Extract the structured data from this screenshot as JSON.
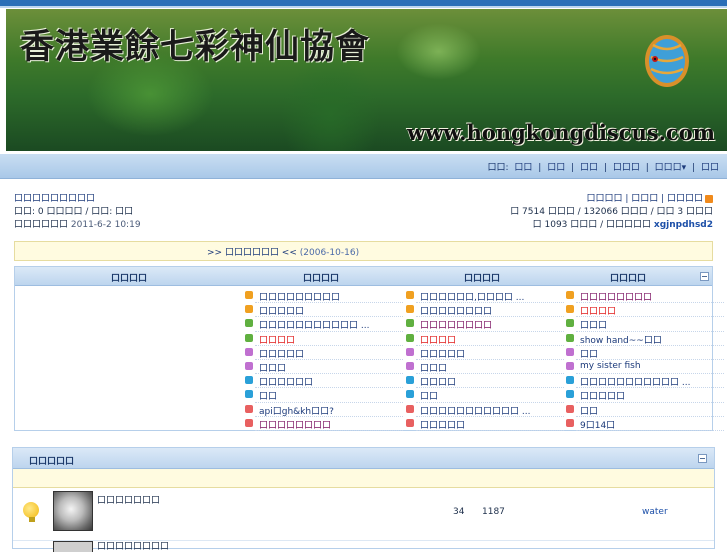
{
  "banner": {
    "title": "香港業餘七彩神仙協會",
    "url": "www.hongkongdiscus.com"
  },
  "nav": {
    "items": [
      "口口:",
      "口口",
      "|",
      "口口",
      "|",
      "口口",
      "|",
      "口口口",
      "|",
      "口口口▾",
      "|",
      "口口"
    ]
  },
  "userinfo": {
    "welcome": "口口口口口口口口口",
    "line2": "口口: 0 口口口口 / 口口: 口口",
    "line3_label": "口口口口口口",
    "last_visit": "2011-6-2 10:19"
  },
  "stats": {
    "links": "口口口口 | 口口口 | 口口口口",
    "line2": "口 7514 口口口 / 132066 口口口 / 口口 3 口口口",
    "line3_prefix": "口 1093 口口口 / 口口口口口",
    "newest_member": "xgjnpdhsd2"
  },
  "notice": {
    "text": ">> 口口口口口口 <<",
    "date": "(2006-10-16)"
  },
  "hot_box": {
    "headers": [
      "口口口口",
      "口口口口",
      "口口口口",
      "口口口口"
    ],
    "columns": [
      {
        "items": [
          {
            "text": "口口口口口口口口口",
            "color": "#1c3a7a",
            "icon_color": "#f0a020"
          },
          {
            "text": "口口口口口",
            "color": "#1c3a7a",
            "icon_color": "#f0a020"
          },
          {
            "text": "口口口口口口口口口口口 ...",
            "color": "#1c3a7a",
            "icon_color": "#60b040"
          },
          {
            "text": "口口口口",
            "color": "#e01818",
            "icon_color": "#60b040"
          },
          {
            "text": "口口口口口",
            "color": "#1c3a7a",
            "icon_color": "#c070d0"
          },
          {
            "text": "口口口",
            "color": "#1c3a7a",
            "icon_color": "#c070d0"
          },
          {
            "text": "口口口口口口",
            "color": "#1c3a7a",
            "icon_color": "#2aa0d8"
          },
          {
            "text": "口口",
            "color": "#1c3a7a",
            "icon_color": "#2aa0d8"
          },
          {
            "text": "api口gh&kh口口?",
            "color": "#1c3a7a",
            "icon_color": "#e86060"
          },
          {
            "text": "口口口口口口口口",
            "color": "#7a1060",
            "icon_color": "#e86060"
          }
        ]
      },
      {
        "items": [
          {
            "text": "口口口口口口,口口口口 ...",
            "color": "#1c3a7a",
            "icon_color": "#f0a020"
          },
          {
            "text": "口口口口口口口口",
            "color": "#1c3a7a",
            "icon_color": "#f0a020"
          },
          {
            "text": "口口口口口口口口",
            "color": "#7a1060",
            "icon_color": "#60b040"
          },
          {
            "text": "口口口口",
            "color": "#e01818",
            "icon_color": "#60b040"
          },
          {
            "text": "口口口口口",
            "color": "#1c3a7a",
            "icon_color": "#c070d0"
          },
          {
            "text": "口口口",
            "color": "#1c3a7a",
            "icon_color": "#c070d0"
          },
          {
            "text": "口口口口",
            "color": "#1c3a7a",
            "icon_color": "#2aa0d8"
          },
          {
            "text": "口口",
            "color": "#1c3a7a",
            "icon_color": "#2aa0d8"
          },
          {
            "text": "口口口口口口口口口口口 ...",
            "color": "#1c3a7a",
            "icon_color": "#e86060"
          },
          {
            "text": "口口口口口",
            "color": "#1c3a7a",
            "icon_color": "#e86060"
          }
        ]
      },
      {
        "items": [
          {
            "text": "口口口口口口口口",
            "color": "#7a1060",
            "icon_color": "#f0a020"
          },
          {
            "text": "口口口口",
            "color": "#e01818",
            "icon_color": "#f0a020"
          },
          {
            "text": "口口口",
            "color": "#1c3a7a",
            "icon_color": "#60b040"
          },
          {
            "text": "show hand~~口口",
            "color": "#1c3a7a",
            "icon_color": "#60b040"
          },
          {
            "text": "口口",
            "color": "#1c3a7a",
            "icon_color": "#c070d0"
          },
          {
            "text": "my sister fish",
            "color": "#1c3a7a",
            "icon_color": "#c070d0"
          },
          {
            "text": "口口口口口口口口口口口 ...",
            "color": "#1c3a7a",
            "icon_color": "#2aa0d8"
          },
          {
            "text": "口口口口口",
            "color": "#1c3a7a",
            "icon_color": "#2aa0d8"
          },
          {
            "text": "口口",
            "color": "#1c3a7a",
            "icon_color": "#e86060"
          },
          {
            "text": "9口14口",
            "color": "#1c3a7a",
            "icon_color": "#e86060"
          }
        ]
      }
    ]
  },
  "forum": {
    "header": "口口口口口",
    "rows": [
      {
        "name": "口口口口口口口",
        "topics": "34",
        "posts": "1187",
        "last_user": "water"
      },
      {
        "name": "口口口口口口口口"
      }
    ]
  },
  "colors": {
    "accent": "#2a6fb7",
    "nav_bg": "#b9d4ee",
    "notice_bg": "#fffbe0"
  }
}
